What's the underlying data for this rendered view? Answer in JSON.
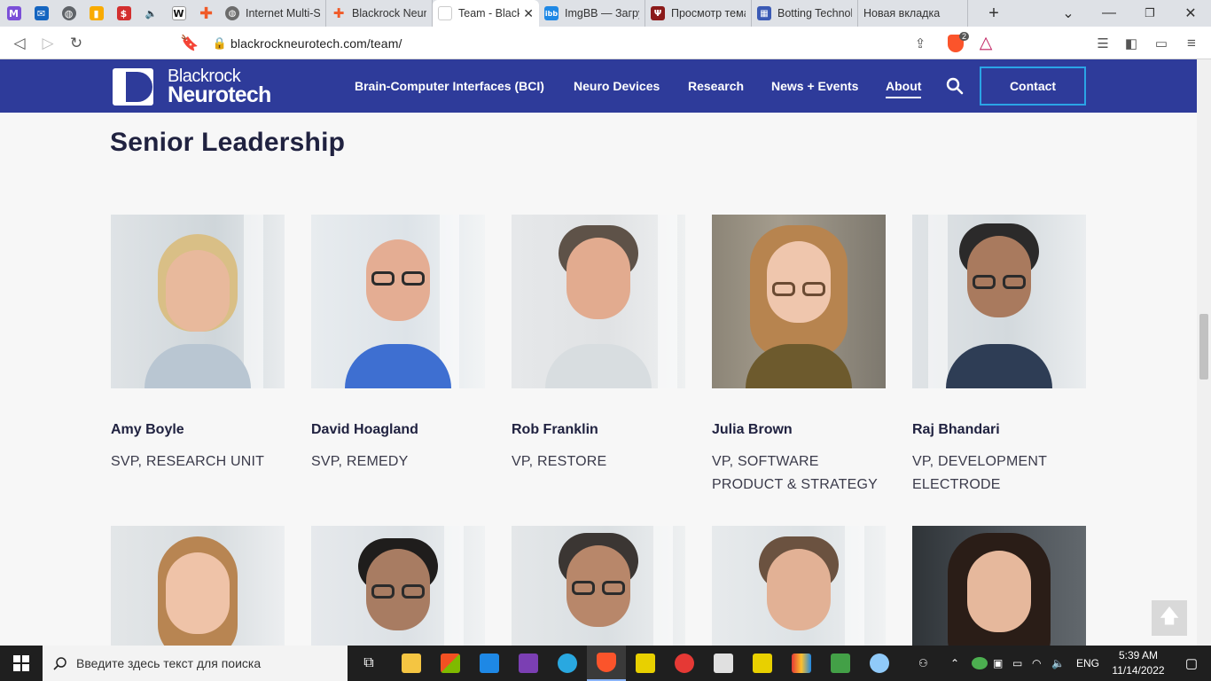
{
  "browser": {
    "tabs": [
      {
        "title": "Internet Multi-S",
        "favicon_color": "#6c6c6c"
      },
      {
        "title": "Blackrock Neuro",
        "favicon_color": "#f05a28"
      },
      {
        "title": "Team - Black",
        "favicon_color": "#2e3b9a",
        "active": true
      },
      {
        "title": "ImgBB — Загру",
        "favicon_color": "#1e88e5"
      },
      {
        "title": "Просмотр тема",
        "favicon_color": "#8b1a1a"
      },
      {
        "title": "Botting Technol",
        "favicon_color": "#3b5ab5"
      },
      {
        "title": "Новая вкладка",
        "favicon_color": "#dee1e6"
      }
    ],
    "pinned_icons": [
      "mail-icon",
      "inbox-icon",
      "globe-icon",
      "analytics-icon",
      "sber-icon",
      "audio-icon",
      "wikipedia-icon",
      "plus-cross-icon"
    ],
    "url": "blackrockneurotech.com/team/",
    "shield_count": "2"
  },
  "site": {
    "logo_line1": "Blackrock",
    "logo_line2": "Neurotech",
    "nav": [
      {
        "label": "Brain-Computer Interfaces (BCI)"
      },
      {
        "label": "Neuro Devices"
      },
      {
        "label": "Research"
      },
      {
        "label": "News + Events"
      },
      {
        "label": "About",
        "active": true
      }
    ],
    "contact_label": "Contact",
    "brand_color": "#2e3b9a",
    "accent_color": "#2aa4e6"
  },
  "section_title": "Senior Leadership",
  "team": [
    {
      "name": "Amy Boyle",
      "role": "SVP, RESEARCH UNIT"
    },
    {
      "name": "David Hoagland",
      "role": "SVP, REMEDY"
    },
    {
      "name": "Rob Franklin",
      "role": "VP, RESTORE"
    },
    {
      "name": "Julia Brown",
      "role": "VP, SOFTWARE PRODUCT & STRATEGY"
    },
    {
      "name": "Raj Bhandari",
      "role": "VP, DEVELOPMENT ELECTRODE"
    }
  ],
  "taskbar": {
    "search_placeholder": "Введите здесь текст для поиска",
    "language": "ENG",
    "time": "5:39 AM",
    "date": "11/14/2022"
  }
}
